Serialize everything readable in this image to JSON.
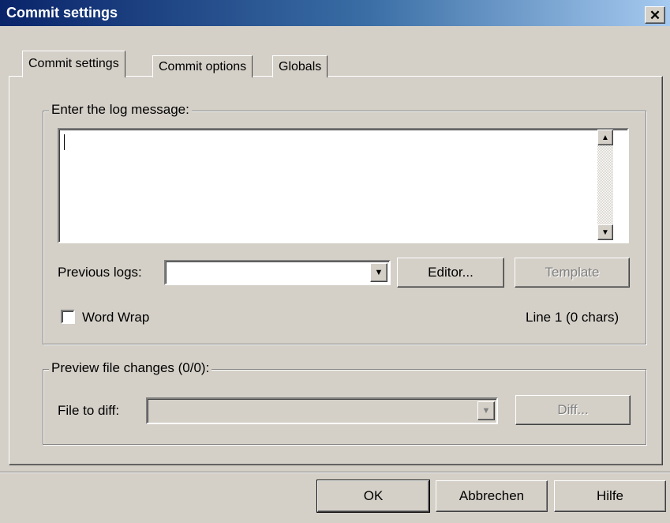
{
  "window": {
    "title": "Commit settings",
    "close_glyph": "✕"
  },
  "tabs": [
    {
      "label": "Commit settings",
      "active": true
    },
    {
      "label": "Commit options",
      "active": false
    },
    {
      "label": "Globals",
      "active": false
    }
  ],
  "log_group": {
    "legend": "Enter the log message:",
    "message_value": "",
    "previous_logs_label": "Previous logs:",
    "previous_logs_value": "",
    "editor_button": "Editor...",
    "template_button": "Template",
    "word_wrap_label": "Word Wrap",
    "word_wrap_checked": false,
    "line_status": "Line 1 (0 chars)"
  },
  "preview_group": {
    "legend": "Preview file changes (0/0):",
    "file_to_diff_label": "File to diff:",
    "file_to_diff_value": "",
    "diff_button": "Diff..."
  },
  "footer": {
    "ok_button": "OK",
    "cancel_button": "Abbrechen",
    "help_button": "Hilfe"
  },
  "icons": {
    "scroll_up": "▲",
    "scroll_down": "▼",
    "dropdown": "▼"
  },
  "colors": {
    "titlebar_start": "#0a246a",
    "titlebar_end": "#a6caf0",
    "face": "#d4d0c8"
  }
}
